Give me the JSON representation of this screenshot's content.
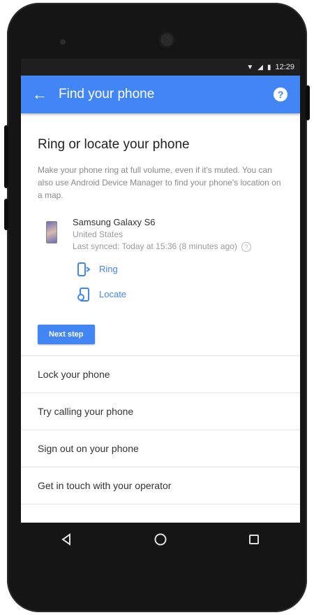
{
  "status_bar": {
    "time": "12:29",
    "wifi_icon": "wifi-icon",
    "signal_icon": "signal-icon",
    "battery_icon": "battery-icon"
  },
  "colors": {
    "accent": "#4285f4",
    "bezel": "#151515"
  },
  "app_bar": {
    "title": "Find your phone",
    "back_icon": "arrow-back-icon",
    "help_icon": "help-icon"
  },
  "section": {
    "title": "Ring or locate your phone",
    "description": "Make your phone ring at full volume, even if it's muted. You can also use Android Device Manager to find your phone's location on a map."
  },
  "device": {
    "name": "Samsung Galaxy S6",
    "country": "United States",
    "last_synced": "Last synced: Today at 15:36 (8 minutes ago)"
  },
  "actions": [
    {
      "label": "Ring",
      "icon": "ring-phone-icon"
    },
    {
      "label": "Locate",
      "icon": "locate-phone-icon"
    }
  ],
  "next_button": "Next step",
  "list_items": [
    "Lock your phone",
    "Try calling your phone",
    "Sign out on your phone",
    "Get in touch with your operator"
  ],
  "nav": {
    "back": "back-triangle-icon",
    "home": "home-circle-icon",
    "recents": "recents-square-icon"
  }
}
